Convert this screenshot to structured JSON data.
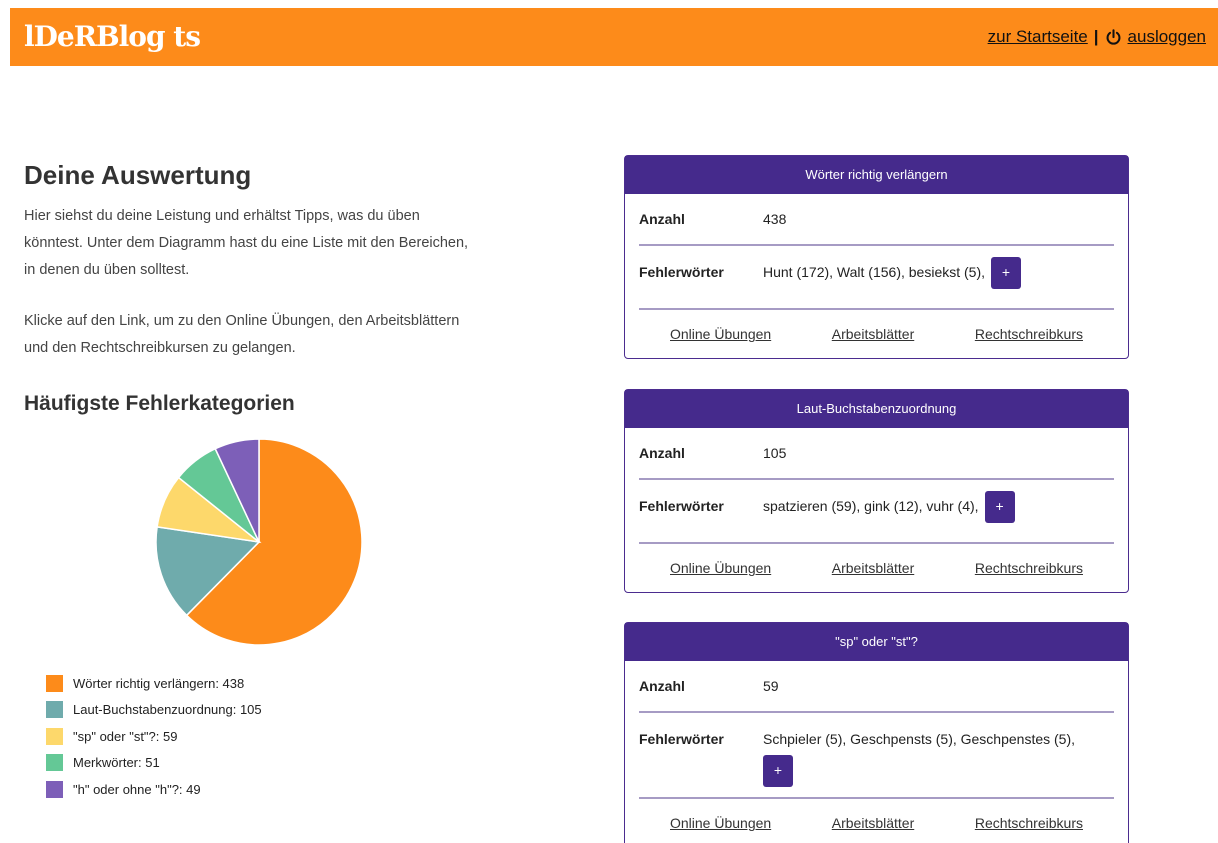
{
  "header": {
    "logo": "lDeRBlog ts",
    "home_link": "zur Startseite",
    "separator": "|",
    "logout_link": "ausloggen",
    "color": "#fd8b1a"
  },
  "main": {
    "title": "Deine Auswertung",
    "intro_p1": "Hier siehst du deine Leistung und erhältst Tipps, was du üben könntest. Unter dem Diagramm hast du eine Liste mit den Bereichen, in denen du üben solltest.",
    "intro_p2": "Klicke auf den Link, um zu den Online Übungen, den Arbeitsblättern und den Rechtschreibkursen zu gelangen.",
    "chart_title": "Häufigste Fehlerkategorien"
  },
  "chart_data": {
    "type": "pie",
    "categories": [
      "Wörter richtig verlängern",
      "Laut-Buchstabenzuordnung",
      "\"sp\" oder \"st\"?",
      "Merkwörter",
      "\"h\" oder ohne \"h\"?"
    ],
    "values": [
      438,
      105,
      59,
      51,
      49
    ],
    "colors": [
      "#fd8b1a",
      "#6fabac",
      "#fdd86b",
      "#64c896",
      "#7d5fb8"
    ],
    "legend": [
      "Wörter richtig verlängern: 438",
      "Laut-Buchstabenzuordnung: 105",
      "\"sp\" oder \"st\"?: 59",
      "Merkwörter: 51",
      "\"h\" oder ohne \"h\"?: 49"
    ]
  },
  "cards": [
    {
      "title": "Wörter richtig verlängern",
      "count_label": "Anzahl",
      "count": "438",
      "words_label": "Fehlerwörter",
      "words": "Hunt (172), Walt (156), besiekst (5),",
      "plus": "+",
      "links": [
        "Online Übungen",
        "Arbeitsblätter",
        "Rechtschreibkurs"
      ]
    },
    {
      "title": "Laut-Buchstabenzuordnung",
      "count_label": "Anzahl",
      "count": "105",
      "words_label": "Fehlerwörter",
      "words": "spatzieren (59), gink (12), vuhr (4),",
      "plus": "+",
      "links": [
        "Online Übungen",
        "Arbeitsblätter",
        "Rechtschreibkurs"
      ]
    },
    {
      "title": "\"sp\" oder \"st\"?",
      "count_label": "Anzahl",
      "count": "59",
      "words_label": "Fehlerwörter",
      "words": "Schpieler (5), Geschpensts (5), Geschpenstes (5),",
      "plus": "+",
      "links": [
        "Online Übungen",
        "Arbeitsblätter",
        "Rechtschreibkurs"
      ]
    }
  ],
  "theme": {
    "card_header": "#452a8c",
    "divider": "#a69bc4"
  }
}
